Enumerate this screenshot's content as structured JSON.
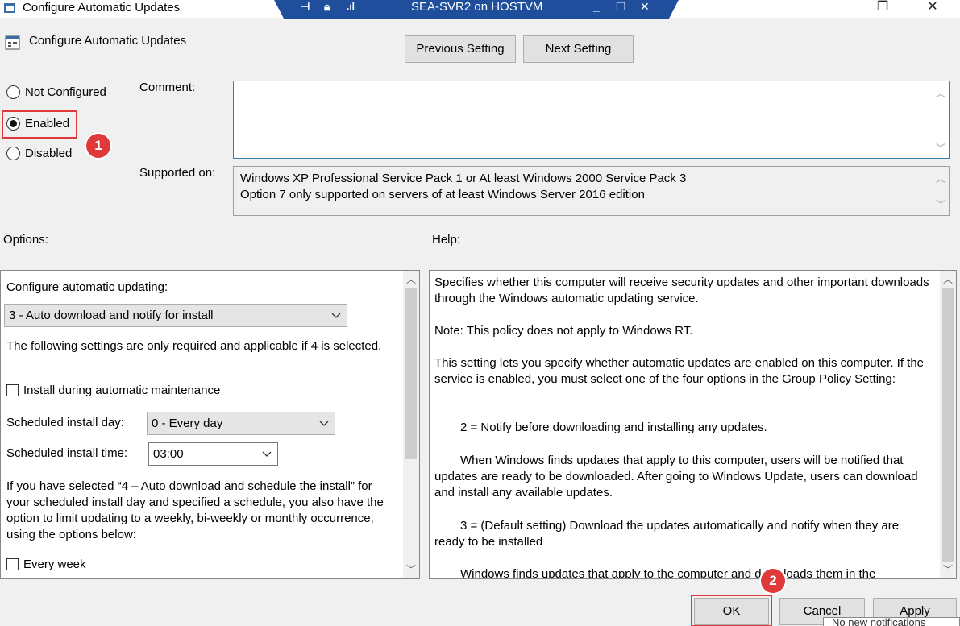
{
  "window": {
    "title": "Configure Automatic Updates",
    "rdp_title": "SEA-SVR2 on HOSTVM",
    "controls": {
      "restore": "❐",
      "close": "✕"
    }
  },
  "header": {
    "title": "Configure Automatic Updates",
    "previous_label": "Previous Setting",
    "next_label": "Next Setting"
  },
  "state": {
    "options": [
      "Not Configured",
      "Enabled",
      "Disabled"
    ],
    "selected": "Enabled"
  },
  "comment": {
    "label": "Comment:",
    "value": ""
  },
  "supported_on": {
    "label": "Supported on:",
    "lines": [
      "Windows XP Professional Service Pack 1 or At least Windows 2000 Service Pack 3",
      "Option 7 only supported on servers of at least Windows Server 2016 edition"
    ]
  },
  "options_pane": {
    "label": "Options:",
    "configure_label": "Configure automatic updating:",
    "configure_value": "3 - Auto download and notify for install",
    "note": "The following settings are only required and applicable if 4 is selected.",
    "install_maintenance_label": "Install during automatic maintenance",
    "install_maintenance_checked": false,
    "install_day_label": "Scheduled install day:",
    "install_day_value": "0 - Every day",
    "install_time_label": "Scheduled install time:",
    "install_time_value": "03:00",
    "schedule_note": "If you have selected “4 – Auto download and schedule the install” for your scheduled install day and specified a schedule, you also have the option to limit updating to a weekly, bi-weekly or monthly occurrence, using the options below:",
    "every_week_label": "Every week",
    "every_week_checked": false
  },
  "help_pane": {
    "label": "Help:",
    "paragraphs": [
      "Specifies whether this computer will receive security updates and other important downloads through the Windows automatic updating service.",
      "Note: This policy does not apply to Windows RT.",
      "This setting lets you specify whether automatic updates are enabled on this computer. If the service is enabled, you must select one of the four options in the Group Policy Setting:",
      "2 = Notify before downloading and installing any updates.",
      "When Windows finds updates that apply to this computer, users will be notified that updates are ready to be downloaded. After going to Windows Update, users can download and install any available updates.",
      "3 = (Default setting) Download the updates automatically and notify when they are ready to be installed",
      "Windows finds updates that apply to the computer and downloads them in the"
    ]
  },
  "footer": {
    "ok_label": "OK",
    "cancel_label": "Cancel",
    "apply_label": "Apply"
  },
  "annotations": {
    "step1": "1",
    "step2": "2"
  },
  "notification": {
    "text": "No new notifications"
  },
  "colors": {
    "highlight": "#e0393a",
    "rdp_bar": "#1f4e9c",
    "focus_border": "#3c7fb1"
  }
}
